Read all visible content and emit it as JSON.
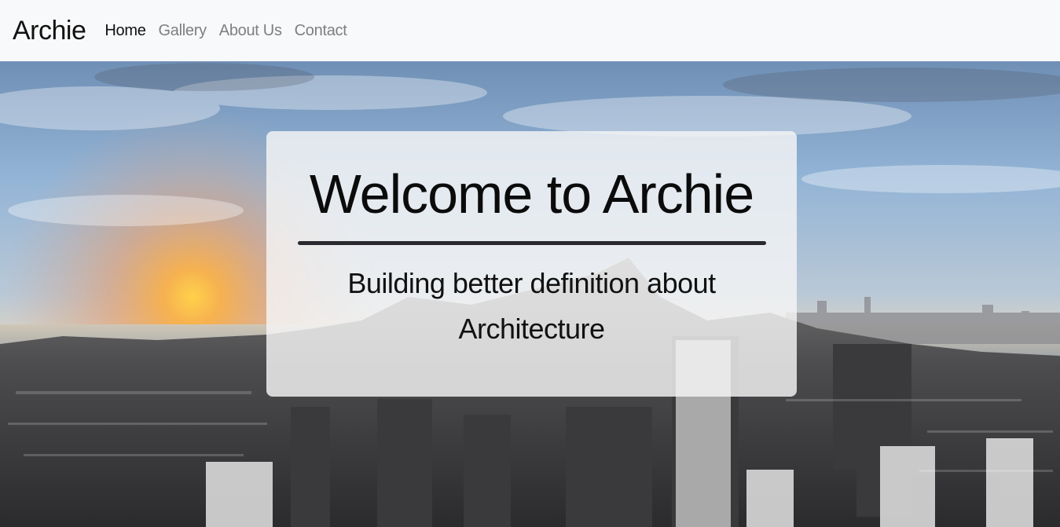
{
  "navbar": {
    "brand": "Archie",
    "links": [
      {
        "label": "Home",
        "active": true
      },
      {
        "label": "Gallery",
        "active": false
      },
      {
        "label": "About Us",
        "active": false
      },
      {
        "label": "Contact",
        "active": false
      }
    ]
  },
  "hero": {
    "title": "Welcome to Archie",
    "subtitle": "Building better definition about Architecture",
    "background": "city-skyline-panorama-image"
  },
  "colors": {
    "navbar_bg": "#f8f9fa",
    "active_link": "#111111",
    "inactive_link": "#7d7f80",
    "card_bg": "rgba(245,245,245,0.82)",
    "rule": "#2a2a2e"
  }
}
